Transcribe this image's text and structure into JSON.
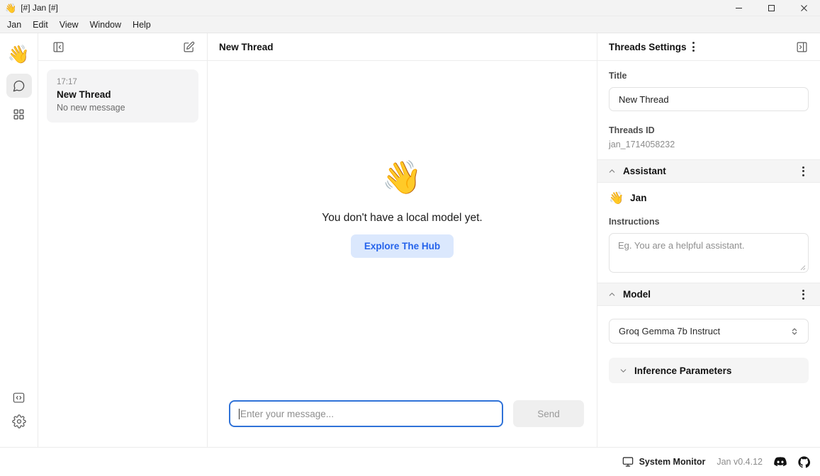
{
  "window": {
    "title": "[#] Jan [#]",
    "logo_emoji": "👋",
    "controls": {
      "minimize": "minimize-icon",
      "maximize": "maximize-icon",
      "close": "close-icon"
    }
  },
  "menubar": {
    "items": [
      {
        "label": "Jan"
      },
      {
        "label": "Edit"
      },
      {
        "label": "View"
      },
      {
        "label": "Window"
      },
      {
        "label": "Help"
      }
    ]
  },
  "rail": {
    "logo_emoji": "👋",
    "items": [
      {
        "name": "chat-icon",
        "active": true
      },
      {
        "name": "grid-icon",
        "active": false
      }
    ],
    "bottom_items": [
      {
        "name": "code-icon"
      },
      {
        "name": "gear-icon"
      }
    ]
  },
  "threads_panel": {
    "collapse_icon": "panel-collapse-left-icon",
    "compose_icon": "compose-icon",
    "threads": [
      {
        "time": "17:17",
        "title": "New Thread",
        "preview": "No new message"
      }
    ]
  },
  "center": {
    "title": "New Thread",
    "empty_state": {
      "emoji": "👋",
      "message": "You don't have a local model yet.",
      "cta_label": "Explore The Hub"
    },
    "composer": {
      "placeholder": "Enter your message...",
      "value": "",
      "send_label": "Send"
    }
  },
  "right_panel": {
    "header_title": "Threads Settings",
    "expand_icon": "panel-collapse-right-icon",
    "title_label": "Title",
    "title_value": "New Thread",
    "threads_id_label": "Threads ID",
    "threads_id_value": "jan_1714058232",
    "assistant": {
      "section_label": "Assistant",
      "emoji": "👋",
      "name": "Jan",
      "instructions_label": "Instructions",
      "instructions_placeholder": "Eg. You are a helpful assistant.",
      "instructions_value": ""
    },
    "model": {
      "section_label": "Model",
      "selected": "Groq Gemma 7b Instruct",
      "inference_label": "Inference Parameters"
    }
  },
  "statusbar": {
    "system_monitor_label": "System Monitor",
    "version": "Jan v0.4.12",
    "discord_icon": "discord-icon",
    "github_icon": "github-icon"
  },
  "colors": {
    "accent_blue": "#2563eb",
    "cta_bg": "#dbe8fd",
    "focus_border": "#2f72d8",
    "panel_gray": "#f5f5f5",
    "card_gray": "#f4f4f5"
  }
}
